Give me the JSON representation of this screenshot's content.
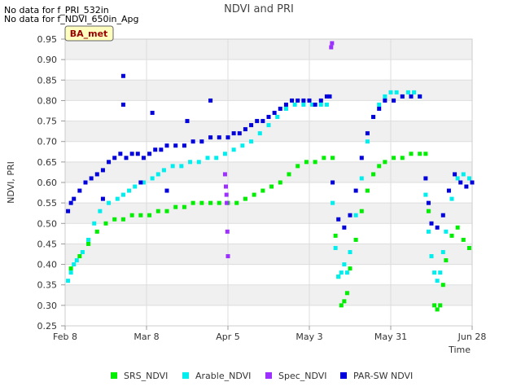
{
  "notes": [
    "No data for f_PRI_532in",
    "No data for f_NDVI_650in_Apg"
  ],
  "site_badge": "BA_met",
  "chart_data": {
    "type": "scatter",
    "title": "NDVI and PRI",
    "xlabel": "Time",
    "ylabel": "NDVI, PRI",
    "ylim": [
      0.25,
      0.95
    ],
    "xlim_days": [
      0,
      140
    ],
    "x_ticks": [
      {
        "label": "Feb 8",
        "day": 0
      },
      {
        "label": "Mar 8",
        "day": 28
      },
      {
        "label": "Apr 5",
        "day": 56
      },
      {
        "label": "May 3",
        "day": 84
      },
      {
        "label": "May 31",
        "day": 112
      },
      {
        "label": "Jun 28",
        "day": 140
      }
    ],
    "y_ticks": [
      "0.25",
      "0.30",
      "0.35",
      "0.40",
      "0.45",
      "0.50",
      "0.55",
      "0.60",
      "0.65",
      "0.70",
      "0.75",
      "0.80",
      "0.85",
      "0.90",
      "0.95"
    ],
    "grid": true,
    "legend_position": "bottom",
    "series": [
      {
        "name": "SRS_NDVI",
        "color": "#00ee00",
        "points": [
          [
            2,
            0.39
          ],
          [
            5,
            0.42
          ],
          [
            8,
            0.45
          ],
          [
            11,
            0.48
          ],
          [
            14,
            0.5
          ],
          [
            17,
            0.51
          ],
          [
            20,
            0.51
          ],
          [
            23,
            0.52
          ],
          [
            26,
            0.52
          ],
          [
            29,
            0.52
          ],
          [
            32,
            0.53
          ],
          [
            35,
            0.53
          ],
          [
            38,
            0.54
          ],
          [
            41,
            0.54
          ],
          [
            44,
            0.55
          ],
          [
            47,
            0.55
          ],
          [
            50,
            0.55
          ],
          [
            53,
            0.55
          ],
          [
            56,
            0.55
          ],
          [
            59,
            0.55
          ],
          [
            62,
            0.56
          ],
          [
            65,
            0.57
          ],
          [
            68,
            0.58
          ],
          [
            71,
            0.59
          ],
          [
            74,
            0.6
          ],
          [
            77,
            0.62
          ],
          [
            80,
            0.64
          ],
          [
            83,
            0.65
          ],
          [
            86,
            0.65
          ],
          [
            89,
            0.66
          ],
          [
            92,
            0.66
          ],
          [
            93,
            0.47
          ],
          [
            94,
            0.37
          ],
          [
            95,
            0.3
          ],
          [
            96,
            0.31
          ],
          [
            97,
            0.33
          ],
          [
            98,
            0.39
          ],
          [
            100,
            0.46
          ],
          [
            102,
            0.53
          ],
          [
            104,
            0.58
          ],
          [
            106,
            0.62
          ],
          [
            108,
            0.64
          ],
          [
            110,
            0.65
          ],
          [
            113,
            0.66
          ],
          [
            116,
            0.66
          ],
          [
            119,
            0.67
          ],
          [
            122,
            0.67
          ],
          [
            124,
            0.67
          ],
          [
            125,
            0.53
          ],
          [
            126,
            0.42
          ],
          [
            127,
            0.3
          ],
          [
            128,
            0.29
          ],
          [
            129,
            0.3
          ],
          [
            130,
            0.35
          ],
          [
            131,
            0.41
          ],
          [
            133,
            0.47
          ],
          [
            135,
            0.49
          ],
          [
            137,
            0.46
          ],
          [
            139,
            0.44
          ]
        ]
      },
      {
        "name": "Arable_NDVI",
        "color": "#00eeee",
        "points": [
          [
            1,
            0.36
          ],
          [
            2,
            0.38
          ],
          [
            3,
            0.4
          ],
          [
            4,
            0.41
          ],
          [
            6,
            0.43
          ],
          [
            8,
            0.46
          ],
          [
            10,
            0.5
          ],
          [
            12,
            0.53
          ],
          [
            15,
            0.55
          ],
          [
            18,
            0.56
          ],
          [
            20,
            0.57
          ],
          [
            22,
            0.58
          ],
          [
            24,
            0.59
          ],
          [
            27,
            0.6
          ],
          [
            30,
            0.61
          ],
          [
            32,
            0.62
          ],
          [
            34,
            0.63
          ],
          [
            37,
            0.64
          ],
          [
            40,
            0.64
          ],
          [
            43,
            0.65
          ],
          [
            46,
            0.65
          ],
          [
            49,
            0.66
          ],
          [
            52,
            0.66
          ],
          [
            55,
            0.67
          ],
          [
            58,
            0.68
          ],
          [
            61,
            0.69
          ],
          [
            64,
            0.7
          ],
          [
            67,
            0.72
          ],
          [
            70,
            0.74
          ],
          [
            73,
            0.76
          ],
          [
            76,
            0.78
          ],
          [
            79,
            0.79
          ],
          [
            82,
            0.79
          ],
          [
            85,
            0.79
          ],
          [
            88,
            0.79
          ],
          [
            90,
            0.79
          ],
          [
            92,
            0.55
          ],
          [
            93,
            0.44
          ],
          [
            94,
            0.37
          ],
          [
            95,
            0.38
          ],
          [
            96,
            0.4
          ],
          [
            97,
            0.38
          ],
          [
            98,
            0.43
          ],
          [
            100,
            0.52
          ],
          [
            102,
            0.61
          ],
          [
            104,
            0.7
          ],
          [
            106,
            0.76
          ],
          [
            108,
            0.79
          ],
          [
            110,
            0.81
          ],
          [
            112,
            0.82
          ],
          [
            114,
            0.82
          ],
          [
            116,
            0.81
          ],
          [
            118,
            0.82
          ],
          [
            120,
            0.82
          ],
          [
            122,
            0.81
          ],
          [
            124,
            0.57
          ],
          [
            125,
            0.48
          ],
          [
            126,
            0.42
          ],
          [
            127,
            0.38
          ],
          [
            128,
            0.36
          ],
          [
            129,
            0.38
          ],
          [
            130,
            0.43
          ],
          [
            131,
            0.48
          ],
          [
            133,
            0.56
          ],
          [
            135,
            0.61
          ],
          [
            137,
            0.62
          ],
          [
            139,
            0.61
          ]
        ]
      },
      {
        "name": "Spec_NDVI",
        "color": "#9b30ff",
        "points": [
          [
            55,
            0.62
          ],
          [
            55.3,
            0.59
          ],
          [
            55.5,
            0.57
          ],
          [
            55.6,
            0.55
          ],
          [
            55.8,
            0.48
          ],
          [
            56,
            0.42
          ],
          [
            91.5,
            0.93
          ],
          [
            91.8,
            0.94
          ]
        ]
      },
      {
        "name": "PAR-SW NDVI",
        "color": "#0000dd",
        "points": [
          [
            1,
            0.53
          ],
          [
            2,
            0.55
          ],
          [
            3,
            0.56
          ],
          [
            5,
            0.58
          ],
          [
            7,
            0.6
          ],
          [
            9,
            0.61
          ],
          [
            11,
            0.62
          ],
          [
            13,
            0.63
          ],
          [
            15,
            0.65
          ],
          [
            17,
            0.66
          ],
          [
            19,
            0.67
          ],
          [
            21,
            0.66
          ],
          [
            23,
            0.67
          ],
          [
            25,
            0.67
          ],
          [
            27,
            0.66
          ],
          [
            29,
            0.67
          ],
          [
            31,
            0.68
          ],
          [
            33,
            0.68
          ],
          [
            35,
            0.69
          ],
          [
            38,
            0.69
          ],
          [
            41,
            0.69
          ],
          [
            44,
            0.7
          ],
          [
            47,
            0.7
          ],
          [
            50,
            0.71
          ],
          [
            53,
            0.71
          ],
          [
            56,
            0.71
          ],
          [
            58,
            0.72
          ],
          [
            60,
            0.72
          ],
          [
            62,
            0.73
          ],
          [
            64,
            0.74
          ],
          [
            66,
            0.75
          ],
          [
            68,
            0.75
          ],
          [
            70,
            0.76
          ],
          [
            72,
            0.77
          ],
          [
            74,
            0.78
          ],
          [
            76,
            0.79
          ],
          [
            78,
            0.8
          ],
          [
            80,
            0.8
          ],
          [
            82,
            0.8
          ],
          [
            84,
            0.8
          ],
          [
            86,
            0.79
          ],
          [
            88,
            0.8
          ],
          [
            90,
            0.81
          ],
          [
            91,
            0.81
          ],
          [
            92,
            0.6
          ],
          [
            94,
            0.51
          ],
          [
            96,
            0.49
          ],
          [
            98,
            0.52
          ],
          [
            100,
            0.58
          ],
          [
            102,
            0.66
          ],
          [
            104,
            0.72
          ],
          [
            106,
            0.76
          ],
          [
            108,
            0.78
          ],
          [
            110,
            0.8
          ],
          [
            113,
            0.8
          ],
          [
            116,
            0.81
          ],
          [
            119,
            0.81
          ],
          [
            122,
            0.81
          ],
          [
            124,
            0.61
          ],
          [
            125,
            0.55
          ],
          [
            126,
            0.5
          ],
          [
            128,
            0.49
          ],
          [
            130,
            0.52
          ],
          [
            132,
            0.58
          ],
          [
            134,
            0.62
          ],
          [
            136,
            0.6
          ],
          [
            138,
            0.59
          ],
          [
            140,
            0.6
          ],
          [
            20,
            0.86
          ],
          [
            20,
            0.79
          ],
          [
            30,
            0.77
          ],
          [
            42,
            0.75
          ],
          [
            50,
            0.8
          ],
          [
            35,
            0.58
          ],
          [
            26,
            0.6
          ],
          [
            13,
            0.56
          ]
        ]
      }
    ]
  }
}
